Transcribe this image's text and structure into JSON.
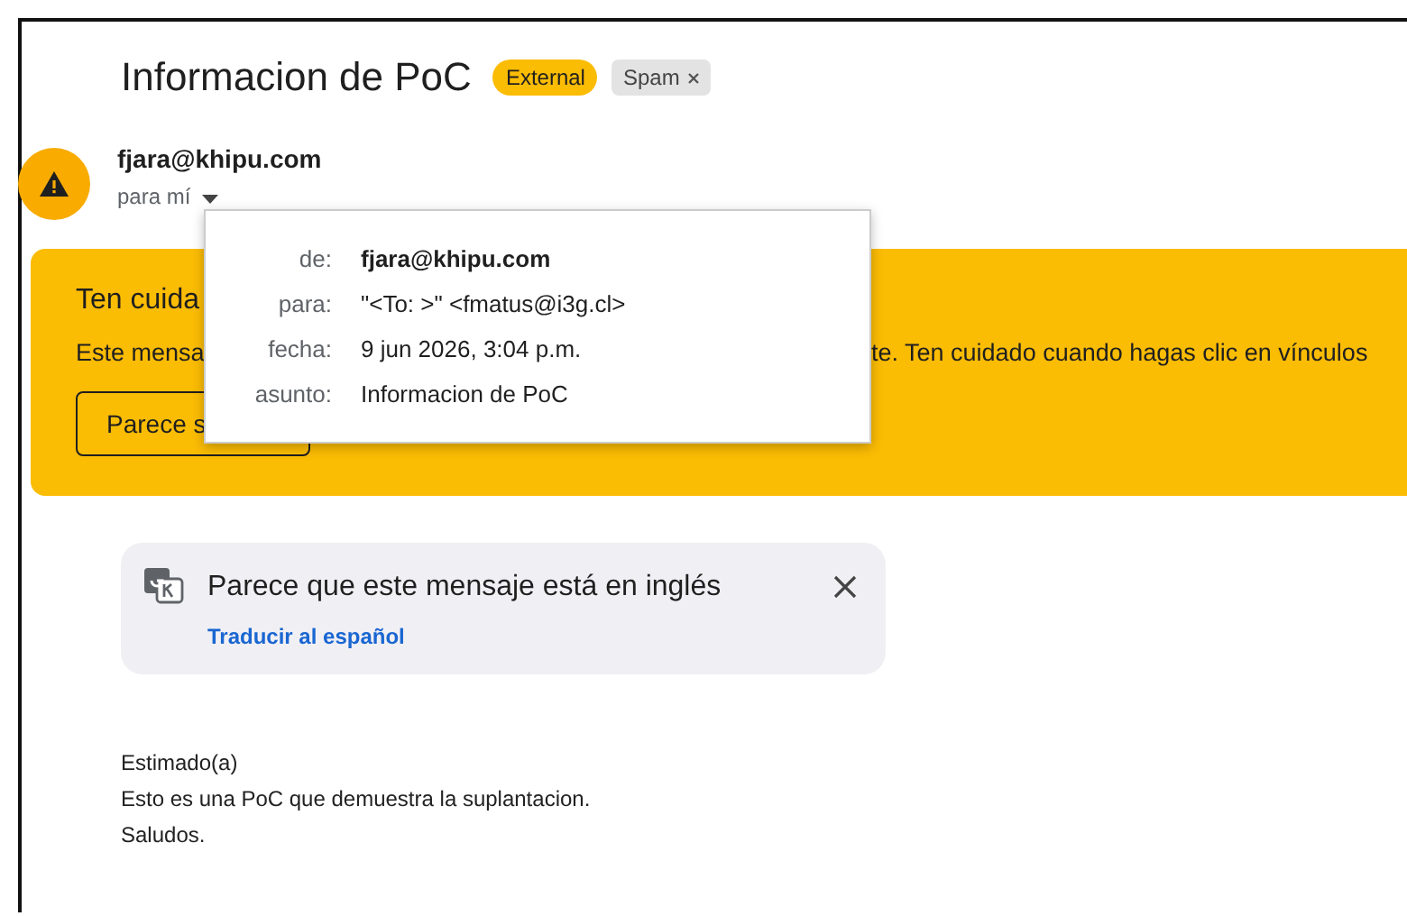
{
  "subject": "Informacion de PoC",
  "labels": [
    {
      "text": "External",
      "kind": "external"
    },
    {
      "text": "Spam",
      "kind": "removable"
    }
  ],
  "sender": {
    "email": "fjara@khipu.com",
    "recipient_line": "para mí"
  },
  "details_popup": {
    "rows": [
      {
        "label": "de:",
        "value": "fjara@khipu.com",
        "kind": "bold"
      },
      {
        "label": "para:",
        "value": "\"<To: >\" <fmatus@i3g.cl>",
        "kind": "plain"
      },
      {
        "label": "fecha:",
        "value": "9 jun 2026, 3:04 p.m.",
        "kind": "plain"
      },
      {
        "label": "asunto:",
        "value": "Informacion de PoC",
        "kind": "plain"
      }
    ]
  },
  "warning": {
    "title": "Ten cuida",
    "text_start": "Este mensa",
    "text_end": "te. Ten cuidado cuando hagas clic en vínculos",
    "button": "Parece s"
  },
  "translate": {
    "message": "Parece que este mensaje está en inglés",
    "link": "Traducir al español"
  },
  "body": [
    "Estimado(a)",
    "Esto es una PoC que demuestra la suplantacion.",
    "Saludos."
  ]
}
